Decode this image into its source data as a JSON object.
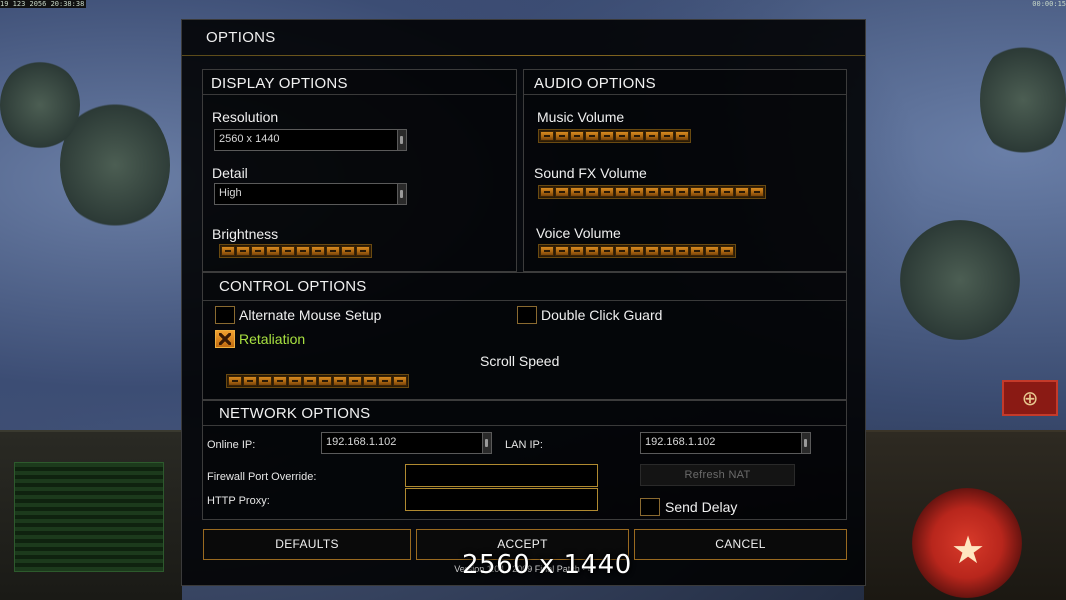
{
  "hud": {
    "top_left": "19 123 2056 20:38:38",
    "top_right": "00:00:15"
  },
  "dialog": {
    "title": "OPTIONS",
    "display": {
      "heading": "DISPLAY OPTIONS",
      "resolution_label": "Resolution",
      "resolution_value": "2560 x 1440",
      "detail_label": "Detail",
      "detail_value": "High",
      "brightness_label": "Brightness",
      "brightness_level": 10,
      "brightness_segments": 10
    },
    "audio": {
      "heading": "AUDIO OPTIONS",
      "music_label": "Music Volume",
      "music_level": 10,
      "sfx_label": "Sound FX Volume",
      "sfx_level": 15,
      "voice_label": "Voice Volume",
      "voice_level": 13
    },
    "control": {
      "heading": "CONTROL OPTIONS",
      "alt_mouse_label": "Alternate Mouse Setup",
      "alt_mouse_checked": false,
      "double_click_label": "Double Click Guard",
      "double_click_checked": false,
      "retaliation_label": "Retaliation",
      "retaliation_checked": true,
      "scroll_speed_label": "Scroll Speed",
      "scroll_speed_level": 12
    },
    "network": {
      "heading": "NETWORK OPTIONS",
      "online_ip_label": "Online IP:",
      "online_ip_value": "192.168.1.102",
      "lan_ip_label": "LAN IP:",
      "lan_ip_value": "192.168.1.102",
      "firewall_label": "Firewall Port Override:",
      "firewall_value": "",
      "http_proxy_label": "HTTP Proxy:",
      "http_proxy_value": "",
      "refresh_nat_label": "Refresh NAT",
      "send_delay_label": "Send Delay",
      "send_delay_checked": false
    },
    "buttons": {
      "defaults": "DEFAULTS",
      "accept": "ACCEPT",
      "cancel": "CANCEL"
    },
    "version": "Version 1.04 · 2009 Final Patch · 4",
    "watermark": "2560 x 1440"
  },
  "colors": {
    "accent": "#c07818",
    "retaliation_text": "#a8e040",
    "panel_border": "#3c3c3c"
  }
}
